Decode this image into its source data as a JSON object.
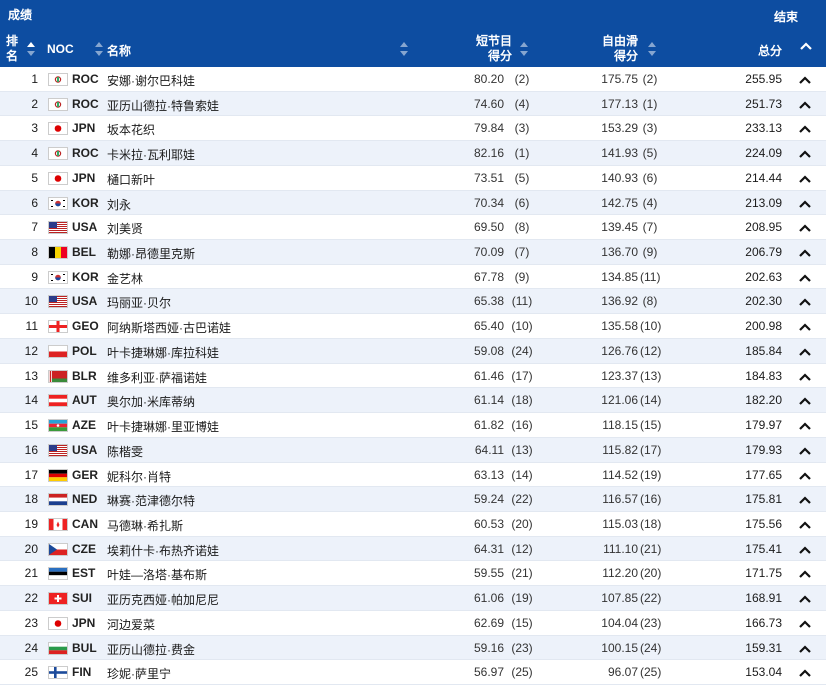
{
  "header": {
    "title": "成绩",
    "end_label": "结束",
    "col_rank": "排名",
    "col_noc": "NOC",
    "col_name": "名称",
    "col_short": "短节目得分",
    "col_free": "自由滑得分",
    "col_total": "总分"
  },
  "colors": {
    "header_bg": "#0d4da1",
    "row_alt": "#edf2fa"
  },
  "rows": [
    {
      "rank": "1",
      "noc": "ROC",
      "flag": "roc",
      "name": "安娜·谢尔巴科娃",
      "sp": "80.20",
      "spr": "(2)",
      "fs": "175.75",
      "fsr": "(2)",
      "total": "255.95"
    },
    {
      "rank": "2",
      "noc": "ROC",
      "flag": "roc",
      "name": "亚历山德拉·特鲁索娃",
      "sp": "74.60",
      "spr": "(4)",
      "fs": "177.13",
      "fsr": "(1)",
      "total": "251.73"
    },
    {
      "rank": "3",
      "noc": "JPN",
      "flag": "jpn",
      "name": "坂本花织",
      "sp": "79.84",
      "spr": "(3)",
      "fs": "153.29",
      "fsr": "(3)",
      "total": "233.13"
    },
    {
      "rank": "4",
      "noc": "ROC",
      "flag": "roc",
      "name": "卡米拉·瓦利耶娃",
      "sp": "82.16",
      "spr": "(1)",
      "fs": "141.93",
      "fsr": "(5)",
      "total": "224.09"
    },
    {
      "rank": "5",
      "noc": "JPN",
      "flag": "jpn",
      "name": "樋口新叶",
      "sp": "73.51",
      "spr": "(5)",
      "fs": "140.93",
      "fsr": "(6)",
      "total": "214.44"
    },
    {
      "rank": "6",
      "noc": "KOR",
      "flag": "kor",
      "name": "刘永",
      "sp": "70.34",
      "spr": "(6)",
      "fs": "142.75",
      "fsr": "(4)",
      "total": "213.09"
    },
    {
      "rank": "7",
      "noc": "USA",
      "flag": "usa",
      "name": "刘美贤",
      "sp": "69.50",
      "spr": "(8)",
      "fs": "139.45",
      "fsr": "(7)",
      "total": "208.95"
    },
    {
      "rank": "8",
      "noc": "BEL",
      "flag": "bel",
      "name": "勒娜·昂德里克斯",
      "sp": "70.09",
      "spr": "(7)",
      "fs": "136.70",
      "fsr": "(9)",
      "total": "206.79"
    },
    {
      "rank": "9",
      "noc": "KOR",
      "flag": "kor",
      "name": "金艺林",
      "sp": "67.78",
      "spr": "(9)",
      "fs": "134.85",
      "fsr": "(11)",
      "total": "202.63"
    },
    {
      "rank": "10",
      "noc": "USA",
      "flag": "usa",
      "name": "玛丽亚·贝尔",
      "sp": "65.38",
      "spr": "(11)",
      "fs": "136.92",
      "fsr": "(8)",
      "total": "202.30"
    },
    {
      "rank": "11",
      "noc": "GEO",
      "flag": "geo",
      "name": "阿纳斯塔西娅·古巴诺娃",
      "sp": "65.40",
      "spr": "(10)",
      "fs": "135.58",
      "fsr": "(10)",
      "total": "200.98"
    },
    {
      "rank": "12",
      "noc": "POL",
      "flag": "pol",
      "name": "叶卡捷琳娜·库拉科娃",
      "sp": "59.08",
      "spr": "(24)",
      "fs": "126.76",
      "fsr": "(12)",
      "total": "185.84"
    },
    {
      "rank": "13",
      "noc": "BLR",
      "flag": "blr",
      "name": "维多利亚·萨福诺娃",
      "sp": "61.46",
      "spr": "(17)",
      "fs": "123.37",
      "fsr": "(13)",
      "total": "184.83"
    },
    {
      "rank": "14",
      "noc": "AUT",
      "flag": "aut",
      "name": "奥尔加·米库蒂纳",
      "sp": "61.14",
      "spr": "(18)",
      "fs": "121.06",
      "fsr": "(14)",
      "total": "182.20"
    },
    {
      "rank": "15",
      "noc": "AZE",
      "flag": "aze",
      "name": "叶卡捷琳娜·里亚博娃",
      "sp": "61.82",
      "spr": "(16)",
      "fs": "118.15",
      "fsr": "(15)",
      "total": "179.97"
    },
    {
      "rank": "16",
      "noc": "USA",
      "flag": "usa",
      "name": "陈楷雯",
      "sp": "64.11",
      "spr": "(13)",
      "fs": "115.82",
      "fsr": "(17)",
      "total": "179.93"
    },
    {
      "rank": "17",
      "noc": "GER",
      "flag": "ger",
      "name": "妮科尔·肖特",
      "sp": "63.13",
      "spr": "(14)",
      "fs": "114.52",
      "fsr": "(19)",
      "total": "177.65"
    },
    {
      "rank": "18",
      "noc": "NED",
      "flag": "ned",
      "name": "琳赛·范津德尔特",
      "sp": "59.24",
      "spr": "(22)",
      "fs": "116.57",
      "fsr": "(16)",
      "total": "175.81"
    },
    {
      "rank": "19",
      "noc": "CAN",
      "flag": "can",
      "name": "马德琳·希扎斯",
      "sp": "60.53",
      "spr": "(20)",
      "fs": "115.03",
      "fsr": "(18)",
      "total": "175.56"
    },
    {
      "rank": "20",
      "noc": "CZE",
      "flag": "cze",
      "name": "埃莉什卡·布热齐诺娃",
      "sp": "64.31",
      "spr": "(12)",
      "fs": "111.10",
      "fsr": "(21)",
      "total": "175.41"
    },
    {
      "rank": "21",
      "noc": "EST",
      "flag": "est",
      "name": "叶娃—洛塔·基布斯",
      "sp": "59.55",
      "spr": "(21)",
      "fs": "112.20",
      "fsr": "(20)",
      "total": "171.75"
    },
    {
      "rank": "22",
      "noc": "SUI",
      "flag": "sui",
      "name": "亚历克西娅·帕加尼尼",
      "sp": "61.06",
      "spr": "(19)",
      "fs": "107.85",
      "fsr": "(22)",
      "total": "168.91"
    },
    {
      "rank": "23",
      "noc": "JPN",
      "flag": "jpn",
      "name": "河边爱菜",
      "sp": "62.69",
      "spr": "(15)",
      "fs": "104.04",
      "fsr": "(23)",
      "total": "166.73"
    },
    {
      "rank": "24",
      "noc": "BUL",
      "flag": "bul",
      "name": "亚历山德拉·费金",
      "sp": "59.16",
      "spr": "(23)",
      "fs": "100.15",
      "fsr": "(24)",
      "total": "159.31"
    },
    {
      "rank": "25",
      "noc": "FIN",
      "flag": "fin",
      "name": "珍妮·萨里宁",
      "sp": "56.97",
      "spr": "(25)",
      "fs": "96.07",
      "fsr": "(25)",
      "total": "153.04"
    }
  ]
}
